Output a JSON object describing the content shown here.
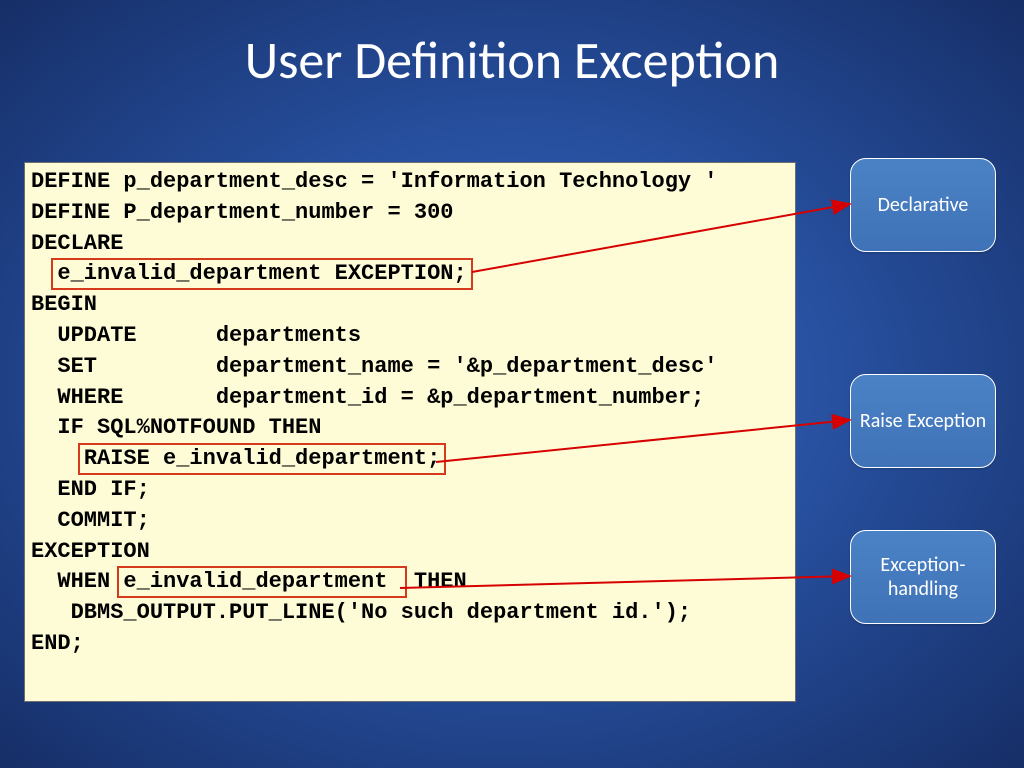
{
  "title": "User Definition Exception",
  "code": {
    "l1": "DEFINE p_department_desc = 'Information Technology '",
    "l2": "DEFINE P_department_number = 300",
    "l3": "DECLARE",
    "l4_hl": "e_invalid_department EXCEPTION;",
    "l5": "BEGIN",
    "l6": "  UPDATE      departments",
    "l7": "  SET         department_name = '&p_department_desc'",
    "l8": "  WHERE       department_id = &p_department_number;",
    "l9": "  IF SQL%NOTFOUND THEN",
    "l10_hl": "RAISE e_invalid_department;",
    "l11": "  END IF;",
    "l12": "  COMMIT;",
    "l13": "EXCEPTION",
    "l14_pre": "  WHEN ",
    "l14_hl": "e_invalid_department ",
    "l14_post": " THEN",
    "l15": "   DBMS_OUTPUT.PUT_LINE('No such department id.');",
    "l16": "END;"
  },
  "pills": {
    "declarative": "Declarative",
    "raise": "Raise Exception",
    "handling": "Exception-handling"
  }
}
